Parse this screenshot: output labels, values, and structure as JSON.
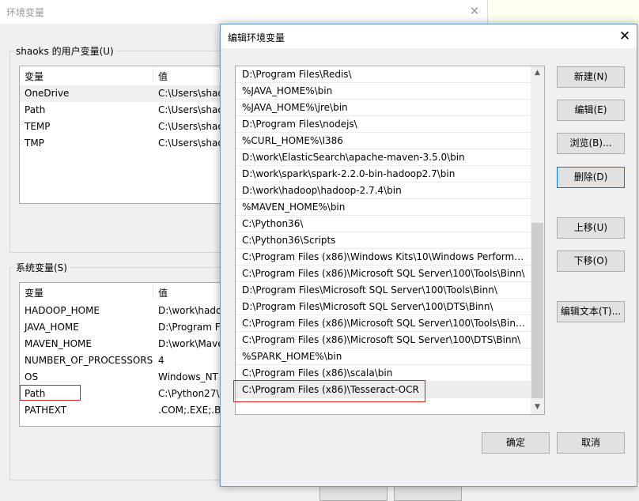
{
  "background_window": {
    "title": "环境变量",
    "user_vars": {
      "label": "shaoks 的用户变量(U)",
      "headers": [
        "变量",
        "值"
      ],
      "rows": [
        {
          "name": "OneDrive",
          "value": "C:\\Users\\shao"
        },
        {
          "name": "Path",
          "value": "C:\\Users\\shao"
        },
        {
          "name": "TEMP",
          "value": "C:\\Users\\shao"
        },
        {
          "name": "TMP",
          "value": "C:\\Users\\shao"
        }
      ]
    },
    "system_vars": {
      "label": "系统变量(S)",
      "headers": [
        "变量",
        "值"
      ],
      "rows": [
        {
          "name": "HADOOP_HOME",
          "value": "D:\\work\\hado"
        },
        {
          "name": "JAVA_HOME",
          "value": "D:\\Program F"
        },
        {
          "name": "MAVEN_HOME",
          "value": "D:\\work\\Mave"
        },
        {
          "name": "NUMBER_OF_PROCESSORS",
          "value": "4"
        },
        {
          "name": "OS",
          "value": "Windows_NT"
        },
        {
          "name": "Path",
          "value": "C:\\Python27\\;"
        },
        {
          "name": "PATHEXT",
          "value": ".COM;.EXE;.BA"
        }
      ]
    }
  },
  "dialog": {
    "title": "编辑环境变量",
    "entries": [
      "D:\\Program Files\\Redis\\",
      "%JAVA_HOME%\\bin",
      "%JAVA_HOME%\\jre\\bin",
      "D:\\Program Files\\nodejs\\",
      "%CURL_HOME%\\I386",
      "D:\\work\\ElasticSearch\\apache-maven-3.5.0\\bin",
      "D:\\work\\spark\\spark-2.2.0-bin-hadoop2.7\\bin",
      "D:\\work\\hadoop\\hadoop-2.7.4\\bin",
      "%MAVEN_HOME%\\bin",
      "C:\\Python36\\",
      "C:\\Python36\\Scripts",
      "C:\\Program Files (x86)\\Windows Kits\\10\\Windows Performan...",
      "C:\\Program Files (x86)\\Microsoft SQL Server\\100\\Tools\\Binn\\",
      "D:\\Program Files\\Microsoft SQL Server\\100\\Tools\\Binn\\",
      "D:\\Program Files\\Microsoft SQL Server\\100\\DTS\\Binn\\",
      "C:\\Program Files (x86)\\Microsoft SQL Server\\100\\Tools\\Binn...",
      "C:\\Program Files (x86)\\Microsoft SQL Server\\100\\DTS\\Binn\\",
      "%SPARK_HOME%\\bin",
      "C:\\Program Files (x86)\\scala\\bin",
      "C:\\Program Files (x86)\\Tesseract-OCR"
    ],
    "selected_index": 19,
    "buttons": {
      "new": "新建(N)",
      "edit": "编辑(E)",
      "browse": "浏览(B)...",
      "delete": "删除(D)",
      "move_up": "上移(U)",
      "move_down": "下移(O)",
      "edit_text": "编辑文本(T)...",
      "ok": "确定",
      "cancel": "取消"
    }
  },
  "icons": {
    "close": "close-icon",
    "scroll_up": "scroll-up-arrow-icon",
    "scroll_down": "scroll-down-arrow-icon"
  },
  "colors": {
    "highlight_box": "#e02020",
    "focus_border": "#0078d7"
  }
}
